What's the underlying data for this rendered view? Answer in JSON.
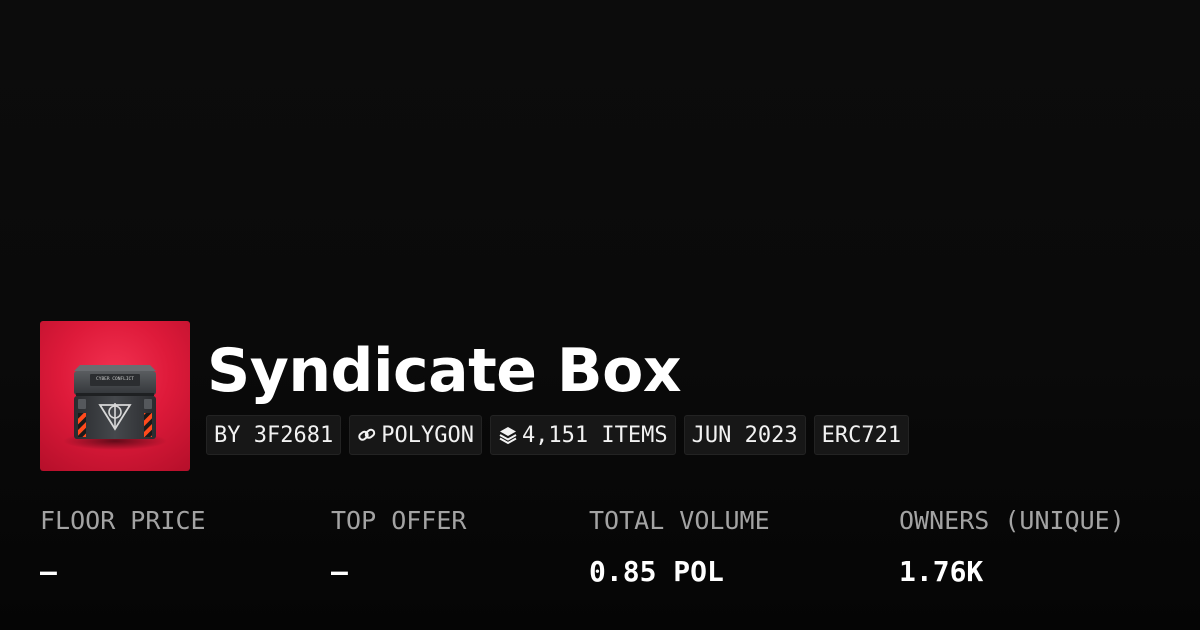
{
  "collection": {
    "name": "Syndicate Box",
    "image_icon": "loot-crate-icon",
    "image_text": "CYBER CONFLICT"
  },
  "tags": [
    {
      "label": "BY 3F2681",
      "icon": ""
    },
    {
      "label": "POLYGON",
      "icon": "chain-link-icon"
    },
    {
      "label": "4,151 ITEMS",
      "icon": "layers-icon"
    },
    {
      "label": "JUN 2023",
      "icon": ""
    },
    {
      "label": "ERC721",
      "icon": ""
    }
  ],
  "stats": {
    "floor_price": {
      "label": "FLOOR PRICE",
      "value": "–"
    },
    "top_offer": {
      "label": "TOP OFFER",
      "value": "–"
    },
    "total_volume": {
      "label": "TOTAL VOLUME",
      "value": "0.85 POL"
    },
    "owners": {
      "label": "OWNERS (UNIQUE)",
      "value": "1.76K"
    }
  },
  "colors": {
    "background": "#0a0a0a",
    "thumbnail_red": "#de1a3a",
    "tag_background": "#171717",
    "label_gray": "#a3a3a3",
    "text_white": "#ffffff"
  }
}
